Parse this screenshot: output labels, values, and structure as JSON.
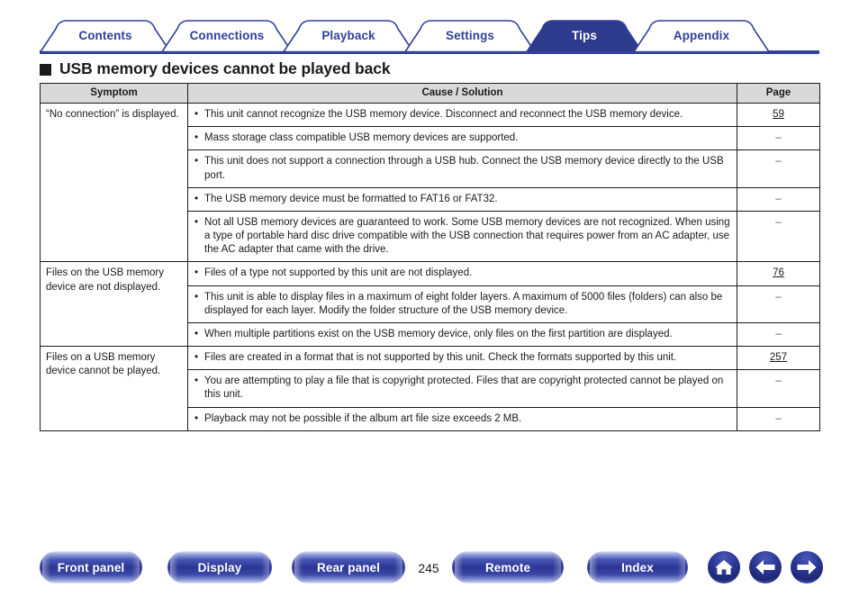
{
  "document": {
    "page_number": "245",
    "heading": "USB memory devices cannot be played back"
  },
  "tabs": [
    {
      "label": "Contents",
      "active": false
    },
    {
      "label": "Connections",
      "active": false
    },
    {
      "label": "Playback",
      "active": false
    },
    {
      "label": "Settings",
      "active": false
    },
    {
      "label": "Tips",
      "active": true
    },
    {
      "label": "Appendix",
      "active": false
    }
  ],
  "table": {
    "headers": [
      "Symptom",
      "Cause / Solution",
      "Page"
    ],
    "groups": [
      {
        "symptom": "“No connection” is displayed.",
        "rows": [
          {
            "cause": "This unit cannot recognize the USB memory device. Disconnect and reconnect the USB memory device.",
            "page": "59",
            "page_is_link": true
          },
          {
            "cause": "Mass storage class compatible USB memory devices are supported.",
            "page": "–",
            "page_is_link": false
          },
          {
            "cause": "This unit does not support a connection through a USB hub. Connect the USB memory device directly to the USB port.",
            "page": "–",
            "page_is_link": false
          },
          {
            "cause": "The USB memory device must be formatted to FAT16 or FAT32.",
            "page": "–",
            "page_is_link": false
          },
          {
            "cause": "Not all USB memory devices are guaranteed to work. Some USB memory devices are not recognized. When using a type of portable hard disc drive compatible with the USB connection that requires power from an AC adapter, use the AC adapter that came with the drive.",
            "page": "–",
            "page_is_link": false
          }
        ]
      },
      {
        "symptom": "Files on the USB memory device are not displayed.",
        "rows": [
          {
            "cause": "Files of a type not supported by this unit are not displayed.",
            "page": "76",
            "page_is_link": true
          },
          {
            "cause": "This unit is able to display files in a maximum of eight folder layers. A maximum of 5000 files (folders) can also be displayed for each layer. Modify the folder structure of the USB memory device.",
            "page": "–",
            "page_is_link": false
          },
          {
            "cause": "When multiple partitions exist on the USB memory device, only files on the first partition are displayed.",
            "page": "–",
            "page_is_link": false
          }
        ]
      },
      {
        "symptom": "Files on a USB memory device cannot be played.",
        "rows": [
          {
            "cause": "Files are created in a format that is not supported by this unit. Check the formats supported by this unit.",
            "page": "257",
            "page_is_link": true
          },
          {
            "cause": "You are attempting to play a file that is copyright protected. Files that are copyright protected cannot be played on this unit.",
            "page": "–",
            "page_is_link": false
          },
          {
            "cause": "Playback may not be possible if the album art file size exceeds 2 MB.",
            "page": "–",
            "page_is_link": false
          }
        ]
      }
    ],
    "bullet_glyph": "•"
  },
  "footer": {
    "buttons": [
      {
        "id": "pill-front",
        "label": "Front panel"
      },
      {
        "id": "pill-display",
        "label": "Display"
      },
      {
        "id": "pill-rear",
        "label": "Rear panel"
      },
      {
        "id": "pill-remote",
        "label": "Remote"
      },
      {
        "id": "pill-index",
        "label": "Index"
      }
    ],
    "nav_icons": [
      {
        "id": "btn-home",
        "name": "home-icon"
      },
      {
        "id": "btn-back",
        "name": "arrow-left-icon"
      },
      {
        "id": "btn-fwd",
        "name": "arrow-right-icon"
      }
    ]
  },
  "colors": {
    "brand_blue": "#31409a",
    "tab_active_fill": "#2e3b8c",
    "header_gray": "#d9d9d9",
    "text": "#1a1a1a"
  }
}
